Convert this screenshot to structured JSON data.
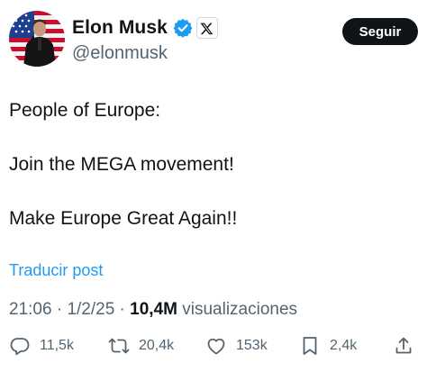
{
  "author": {
    "display_name": "Elon Musk",
    "handle": "@elonmusk",
    "verified": true,
    "affiliate_badge": "x-logo-icon"
  },
  "follow_button": {
    "label": "Seguir"
  },
  "tweet": {
    "lines": [
      "People of Europe:",
      "Join the MEGA movement!",
      "Make Europe Great Again!!"
    ]
  },
  "translate_link": "Traducir post",
  "meta": {
    "time": "21:06",
    "separator1": "·",
    "date": "1/2/25",
    "separator2": "·",
    "views_count": "10,4M",
    "views_label": "visualizaciones"
  },
  "actions": {
    "replies": "11,5k",
    "reposts": "20,4k",
    "likes": "153k",
    "bookmarks": "2,4k"
  },
  "colors": {
    "accent": "#1d9bf0",
    "text": "#0f1419",
    "secondary": "#536471",
    "button_bg": "#0f1419"
  }
}
